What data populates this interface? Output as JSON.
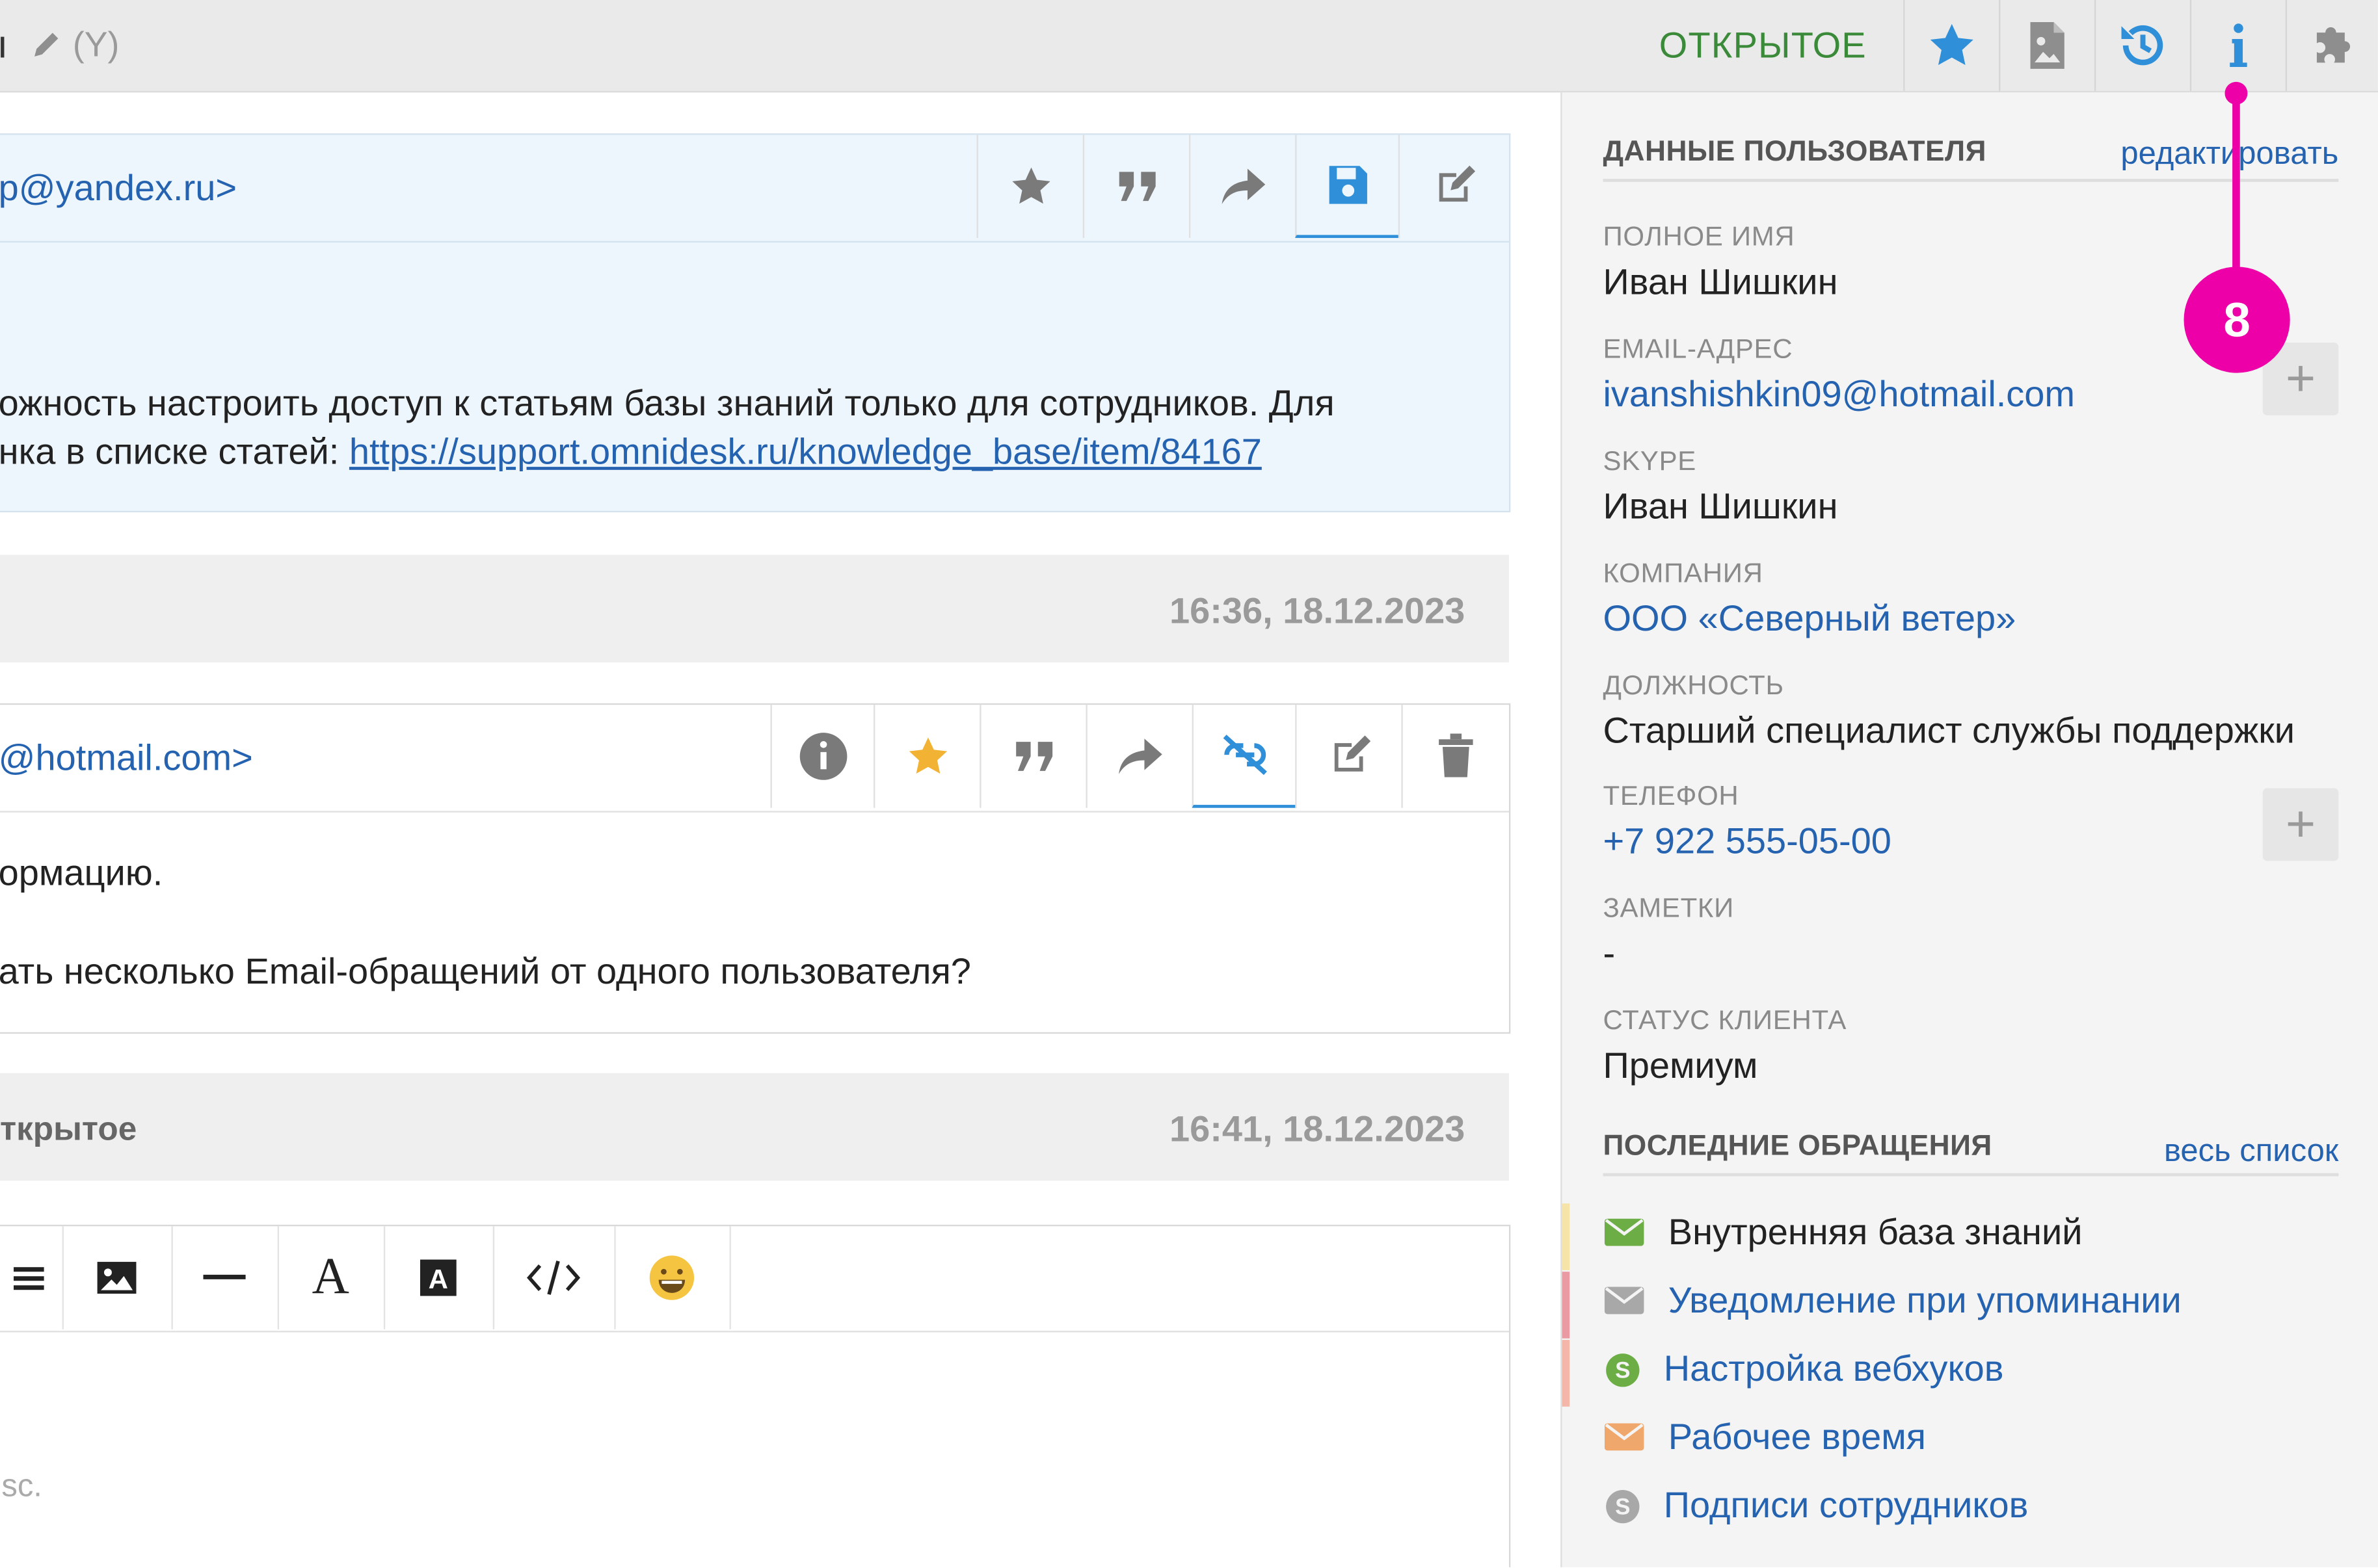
{
  "header": {
    "left_fragment": "ı",
    "edit_hint": "(Y)",
    "status": "ОТКРЫТОЕ",
    "status_color": "#3a8a3a",
    "icons": [
      "star-icon",
      "file-image-icon",
      "history-icon",
      "info-icon",
      "puzzle-icon"
    ]
  },
  "annotation": {
    "number": "8",
    "color": "#ee00a8"
  },
  "messages": [
    {
      "from_fragment": "p@yandex.ru>",
      "body_line1": "ожность настроить доступ к статьям базы знаний только для сотрудников. Для",
      "body_line2_prefix": "нка в списке статей: ",
      "body_link": "https://support.omnidesk.ru/knowledge_base/item/84167"
    },
    {
      "timestamp": "16:36, 18.12.2023",
      "from_fragment": "@hotmail.com>",
      "body_line1": "ормацию.",
      "body_line2": "ать несколько Email-обращений от одного пользователя?"
    }
  ],
  "reply_meta": {
    "status_fragment": "ткрытое",
    "timestamp": "16:41, 18.12.2023"
  },
  "editor": {
    "placeholder_fragment": "sc."
  },
  "sidebar": {
    "user_section_title": "ДАННЫЕ ПОЛЬЗОВАТЕЛЯ",
    "edit_link": "редактировать",
    "fields": [
      {
        "label": "ПОЛНОЕ ИМЯ",
        "value": "Иван Шишкин"
      },
      {
        "label": "EMAIL-АДРЕС",
        "value": "ivanshishkin09@hotmail.com"
      },
      {
        "label": "SKYPE",
        "value": "Иван Шишкин"
      },
      {
        "label": "КОМПАНИЯ",
        "value": "ООО «Северный ветер»"
      },
      {
        "label": "ДОЛЖНОСТЬ",
        "value": "Старший специалист службы поддержки"
      },
      {
        "label": "ТЕЛЕФОН",
        "value": "+7 922 555-05-00"
      },
      {
        "label": "ЗАМЕТКИ",
        "value": "-"
      },
      {
        "label": "СТАТУС КЛИЕНТА",
        "value": "Премиум"
      }
    ],
    "requests_title": "ПОСЛЕДНИЕ ОБРАЩЕНИЯ",
    "all_link": "весь список",
    "requests": [
      {
        "title": "Внутренняя база знаний",
        "channel": "email",
        "icon_color": "#6cae45",
        "bar_color": "#f6e3a8",
        "is_link": false
      },
      {
        "title": "Уведомление при упоминании",
        "channel": "email",
        "icon_color": "#a8a8a8",
        "bar_color": "#e99aa2",
        "is_link": true
      },
      {
        "title": "Настройка вебхуков",
        "channel": "skype",
        "icon_color": "#6cae45",
        "bar_color": "#f3b6a8",
        "is_link": true
      },
      {
        "title": "Рабочее время",
        "channel": "email",
        "icon_color": "#f0a76b",
        "bar_color": "",
        "is_link": true
      },
      {
        "title": "Подписи сотрудников",
        "channel": "skype",
        "icon_color": "#a8a8a8",
        "bar_color": "",
        "is_link": true
      }
    ]
  }
}
